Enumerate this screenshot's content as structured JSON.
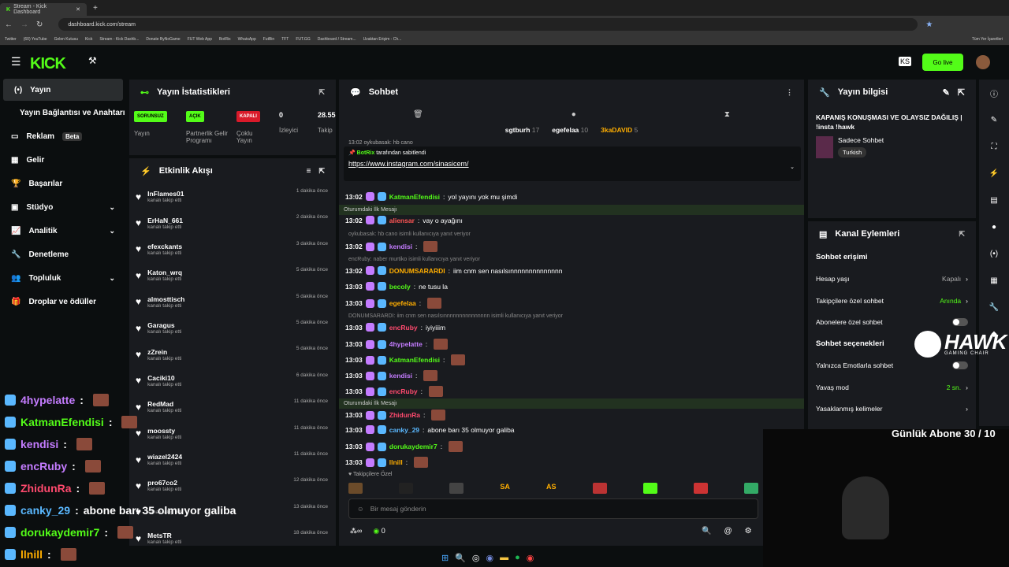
{
  "browser": {
    "tab_title": "Stream - Kick Dashboard",
    "url": "dashboard.kick.com/stream",
    "bookmarks": [
      "Twitter",
      "(60) YouTube",
      "Gelen Kutusu",
      "Kick",
      "Stream - Kick Dashb...",
      "Donate ByNoGame",
      "FUT Web App",
      "BotRix",
      "WhatsApp",
      "FutBin",
      "TFT",
      "FUT.GG",
      "Dashboard / Stream...",
      "Uzaktan Erişim - Ch..."
    ],
    "all_bookmarks": "Tüm Yer İşaretleri"
  },
  "brand": {
    "logo": "KICK",
    "go_live": "Go live",
    "accent": "#53fc18"
  },
  "sidebar": {
    "items": [
      {
        "label": "Yayın"
      },
      {
        "label": "Yayın Bağlantısı ve Anahtarı"
      },
      {
        "label": "Reklam",
        "badge": "Beta"
      },
      {
        "label": "Gelir"
      },
      {
        "label": "Başarılar"
      },
      {
        "label": "Stüdyo"
      },
      {
        "label": "Analitik"
      },
      {
        "label": "Denetleme"
      },
      {
        "label": "Topluluk"
      },
      {
        "label": "Droplar ve ödüller"
      }
    ]
  },
  "stats": {
    "title": "Yayın İstatistikleri",
    "items": [
      {
        "badge": "SORUNSUZ",
        "label": "Yayın"
      },
      {
        "badge": "AÇIK",
        "label": "Partnerlik Gelir Programı"
      },
      {
        "badge": "KAPALI",
        "label": "Çoklu Yayın"
      },
      {
        "value": "0",
        "label": "İzleyici"
      },
      {
        "value": "28.55",
        "label": "Takip"
      }
    ]
  },
  "activity": {
    "title": "Etkinlik Akışı",
    "subtitle": "kanalı takip etti",
    "rows": [
      {
        "name": "InFlames01",
        "time": "1 dakika önce"
      },
      {
        "name": "ErHaN_661",
        "time": "2 dakika önce"
      },
      {
        "name": "efexckants",
        "time": "3 dakika önce"
      },
      {
        "name": "Katon_wrq",
        "time": "5 dakika önce"
      },
      {
        "name": "almosttisch",
        "time": "5 dakika önce"
      },
      {
        "name": "Garagus",
        "time": "5 dakika önce"
      },
      {
        "name": "zZrein",
        "time": "5 dakika önce"
      },
      {
        "name": "Caciki10",
        "time": "6 dakika önce"
      },
      {
        "name": "RedMad",
        "time": "11 dakika önce"
      },
      {
        "name": "moossty",
        "time": "11 dakika önce"
      },
      {
        "name": "wiazel2424",
        "time": "11 dakika önce"
      },
      {
        "name": "pro67co2",
        "time": "12 dakika önce"
      },
      {
        "name": "",
        "time": "13 dakika önce"
      },
      {
        "name": "MetsTR",
        "time": "18 dakika önce"
      }
    ]
  },
  "chat": {
    "title": "Sohbet",
    "top_gifters": [
      {
        "name": "sgtburh",
        "count": "17"
      },
      {
        "name": "egefelaa",
        "count": "10"
      },
      {
        "name": "3kaDAVID",
        "count": "5"
      }
    ],
    "partial_top": "13:02 oykubasak: hb cano",
    "pinned": {
      "by": "BotRix",
      "by_suffix": "tarafından sabitlendi",
      "link": "https://www.instagram.com/sinasicem/"
    },
    "first_message_label": "Oturumdaki İlk Mesajı",
    "messages": [
      {
        "time": "13:02",
        "user": "KatmanEfendisi",
        "color": "#53fc18",
        "text": "yol yayını yok mu şimdi"
      },
      {
        "time": "13:02",
        "user": "aliensar",
        "color": "#ff5555",
        "text": "vay o ayağını"
      },
      {
        "reply": "oykubasak: hb cano isimli kullanıcıya yanıt veriyor",
        "time": "13:02",
        "user": "kendisi",
        "color": "#c47cff",
        "text": ""
      },
      {
        "reply": "encRuby: naber murtiko  isimli kullanıcıya yanıt veriyor",
        "time": "13:02",
        "user": "DONUMSARARDI",
        "color": "#ffae00",
        "text": "iim cnm sen nasılsınnnnnnnnnnnnnn"
      },
      {
        "time": "13:03",
        "user": "becoly",
        "color": "#53fc18",
        "text": "ne tusu la"
      },
      {
        "time": "13:03",
        "user": "egefelaa",
        "color": "#ffae00",
        "text": ""
      },
      {
        "reply": "DONUMSARARDI: iim cnm sen nasılsınnnnnnnnnnnnnnn isimli kullanıcıya yanıt veriyor",
        "time": "13:03",
        "user": "encRuby",
        "color": "#ff4a6e",
        "text": "iyiyiiim"
      },
      {
        "time": "13:03",
        "user": "4hypelatte",
        "color": "#c47cff",
        "text": ""
      },
      {
        "time": "13:03",
        "user": "KatmanEfendisi",
        "color": "#53fc18",
        "text": ""
      },
      {
        "time": "13:03",
        "user": "kendisi",
        "color": "#c47cff",
        "text": ""
      },
      {
        "time": "13:03",
        "user": "encRuby",
        "color": "#ff4a6e",
        "text": ""
      },
      {
        "time": "13:03",
        "user": "ZhidunRa",
        "color": "#ff4a6e",
        "text": ""
      },
      {
        "time": "13:03",
        "user": "canky_29",
        "color": "#5ab8ff",
        "text": "abone barı 35 olmuyor galiba"
      },
      {
        "time": "13:03",
        "user": "dorukaydemir7",
        "color": "#53fc18",
        "text": ""
      },
      {
        "time": "13:03",
        "user": "llnill",
        "color": "#ffae00",
        "text": ""
      }
    ],
    "followers_only": "Takipçilere Özel",
    "emote_codes": [
      "SA",
      "AS"
    ],
    "input_placeholder": "Bir mesaj gönderin",
    "viewer_count": "0"
  },
  "info": {
    "title": "Yayın bilgisi",
    "stream_title": "KAPANIŞ KONUŞMASI VE OLAYSIZ DAĞILIŞ | !insta !hawk",
    "category": "Sadece Sohbet",
    "language": "Turkish"
  },
  "channel_actions": {
    "title": "Kanal Eylemleri",
    "access_title": "Sohbet erişimi",
    "rows": [
      {
        "label": "Hesap yaşı",
        "value": "Kapalı"
      },
      {
        "label": "Takipçilere özel sohbet",
        "value": "Anında"
      },
      {
        "label": "Abonelere özel sohbet",
        "toggle": true
      }
    ],
    "options_title": "Sohbet seçenekleri",
    "option_rows": [
      {
        "label": "Yalnızca Emotlarla sohbet",
        "toggle": true
      },
      {
        "label": "Yavaş mod",
        "value": "2 sn."
      },
      {
        "label": "Yasaklanmış kelimeler",
        "value": ""
      }
    ]
  },
  "overlay": {
    "sponsor": "HAWK",
    "sponsor_sub": "GAMING CHAIR",
    "goal": "Günlük Abone 30 / 10",
    "chat": [
      {
        "user": "4hypelatte",
        "color": "#c47cff",
        "text": ""
      },
      {
        "user": "KatmanEfendisi",
        "color": "#53fc18",
        "text": ""
      },
      {
        "user": "kendisi",
        "color": "#c47cff",
        "text": ""
      },
      {
        "user": "encRuby",
        "color": "#c47cff",
        "text": ""
      },
      {
        "user": "ZhidunRa",
        "color": "#ff4a6e",
        "text": ""
      },
      {
        "user": "canky_29",
        "color": "#5ab8ff",
        "text": "abone barı 35 olmuyor galiba"
      },
      {
        "user": "dorukaydemir7",
        "color": "#53fc18",
        "text": ""
      },
      {
        "user": "llnill",
        "color": "#ffae00",
        "text": ""
      }
    ]
  }
}
